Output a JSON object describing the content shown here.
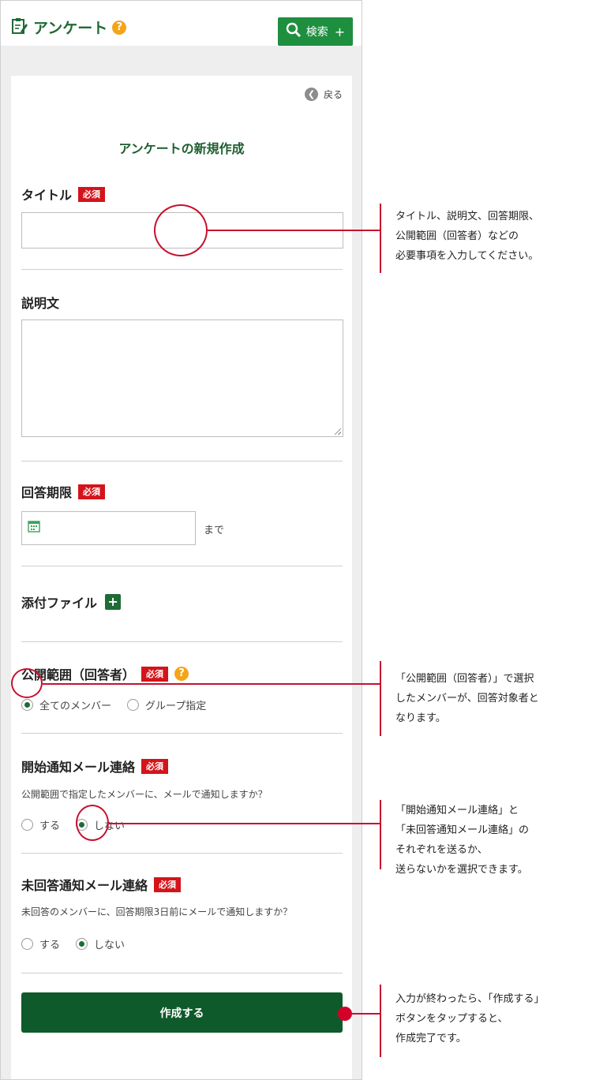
{
  "header": {
    "app_title": "アンケート",
    "help_glyph": "?",
    "search_label": "検索",
    "search_plus": "+"
  },
  "form": {
    "back_label": "戻る",
    "page_title": "アンケートの新規作成",
    "required_badge": "必須",
    "title_label": "タイトル",
    "title_value": "",
    "description_label": "説明文",
    "description_value": "",
    "deadline_label": "回答期限",
    "deadline_value": "",
    "deadline_suffix": "まで",
    "attachment_label": "添付ファイル",
    "attachment_add": "+",
    "scope_label": "公開範囲（回答者）",
    "scope_options": [
      "全てのメンバー",
      "グループ指定"
    ],
    "scope_selected": "全てのメンバー",
    "start_mail_label": "開始通知メール連絡",
    "start_mail_note": "公開範囲で指定したメンバーに、メールで通知しますか？",
    "start_mail_options": [
      "する",
      "しない"
    ],
    "start_mail_selected": "しない",
    "unanswered_mail_label": "未回答通知メール連絡",
    "unanswered_mail_note": "未回答のメンバーに、回答期限3日前にメールで通知しますか？",
    "unanswered_mail_options": [
      "する",
      "しない"
    ],
    "unanswered_mail_selected": "しない",
    "submit_label": "作成する"
  },
  "callouts": [
    {
      "lines": [
        "タイトル、説明文、回答期限、",
        "公開範囲（回答者）などの",
        "必要事項を入力してください。"
      ]
    },
    {
      "lines": [
        "「公開範囲（回答者）」で選択",
        "したメンバーが、回答対象者と",
        "なります。"
      ]
    },
    {
      "lines": [
        "「開始通知メール連絡」と",
        "「未回答通知メール連絡」の",
        "それぞれを送るか、",
        "送らないかを選択できます。"
      ]
    },
    {
      "lines": [
        "入力が終わったら、「作成する」",
        "ボタンをタップすると、",
        "作成完了です。"
      ]
    }
  ],
  "colors": {
    "brand_green": "#1d8f3f",
    "dark_green": "#0f5a2a",
    "required_red": "#d4141b",
    "help_orange": "#f3a51a",
    "callout_red": "#c8102e"
  },
  "icons": {
    "app": "survey-icon",
    "search": "magnifier-icon",
    "back": "chevron-left-icon",
    "calendar": "calendar-icon"
  }
}
